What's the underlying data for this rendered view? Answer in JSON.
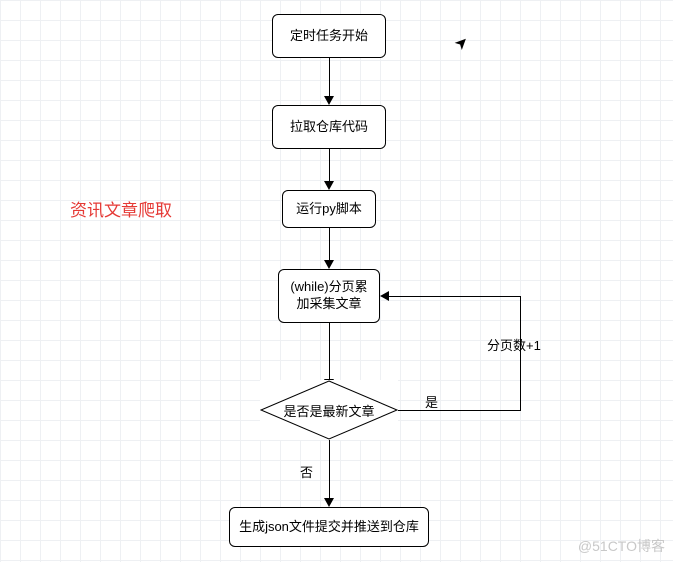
{
  "title": "资讯文章爬取",
  "nodes": {
    "n1": "定时任务开始",
    "n2": "拉取仓库代码",
    "n3": "运行py脚本",
    "n4": "(while)分页累加采集文章",
    "n5": "是否是最新文章",
    "n6": "生成json文件提交并推送到仓库"
  },
  "labels": {
    "loop": "分页数+1",
    "yes": "是",
    "no": "否"
  },
  "watermark": "@51CTO博客",
  "cursor_glyph": "➤"
}
